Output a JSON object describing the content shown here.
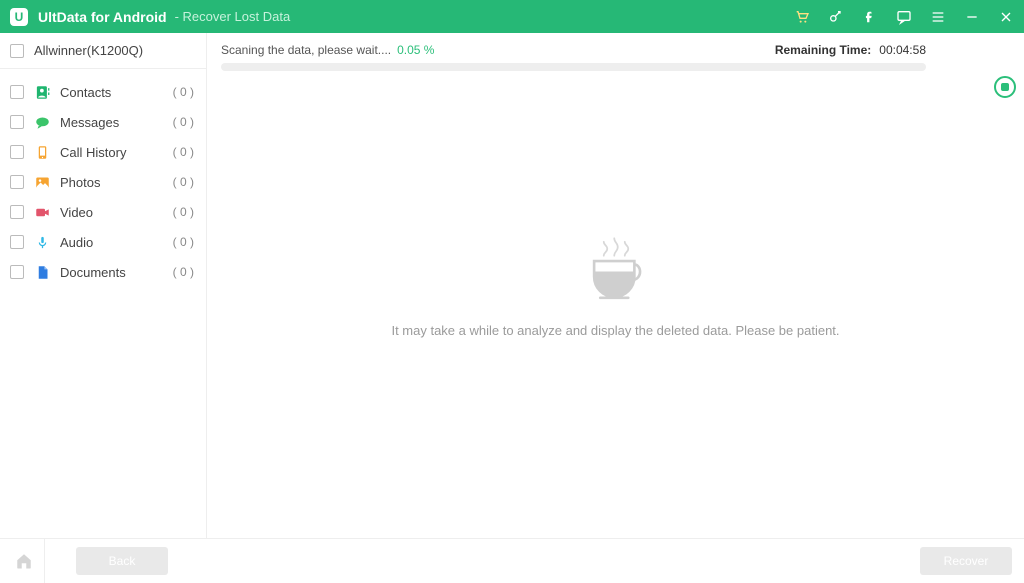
{
  "header": {
    "title": "UltData for Android",
    "subtitle": "- Recover Lost Data"
  },
  "device": {
    "name": "Allwinner(K1200Q)"
  },
  "categories": [
    {
      "key": "contacts",
      "label": "Contacts",
      "count": "( 0 )"
    },
    {
      "key": "messages",
      "label": "Messages",
      "count": "( 0 )"
    },
    {
      "key": "calls",
      "label": "Call History",
      "count": "( 0 )"
    },
    {
      "key": "photos",
      "label": "Photos",
      "count": "( 0 )"
    },
    {
      "key": "video",
      "label": "Video",
      "count": "( 0 )"
    },
    {
      "key": "audio",
      "label": "Audio",
      "count": "( 0 )"
    },
    {
      "key": "documents",
      "label": "Documents",
      "count": "( 0 )"
    }
  ],
  "scan": {
    "text": "Scaning the data, please wait....",
    "percent": "0.05 %",
    "remaining_label": "Remaining Time:",
    "remaining_time": "00:04:58"
  },
  "main_msg": "It may take a while to analyze and display the deleted data. Please be patient.",
  "footer": {
    "back_label": "Back",
    "recover_label": "Recover"
  }
}
